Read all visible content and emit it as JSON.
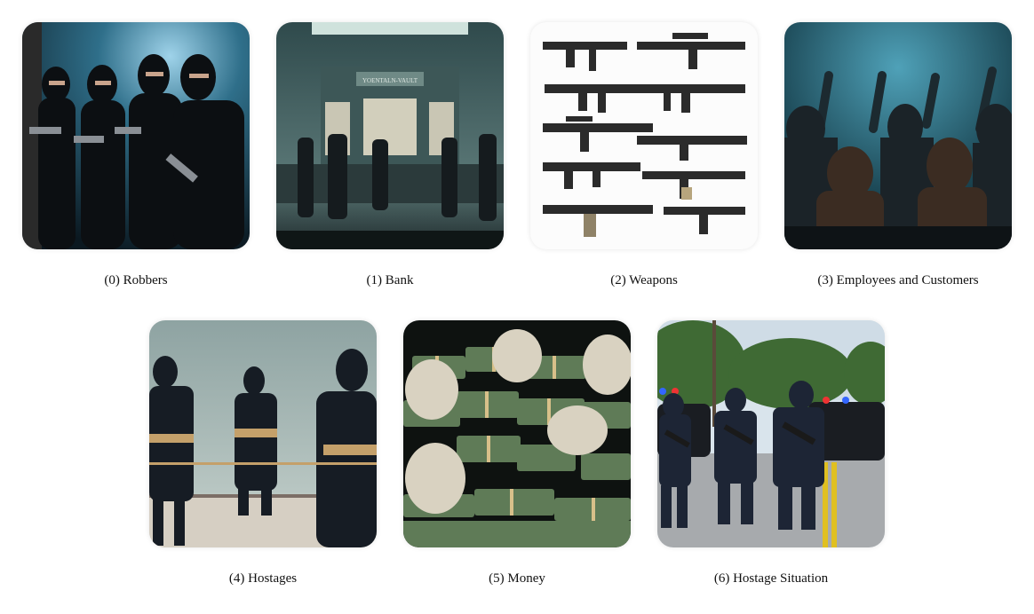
{
  "items": [
    {
      "caption": "(0) Robbers"
    },
    {
      "caption": "(1) Bank",
      "sign_text": "YOENTALN-VAULT"
    },
    {
      "caption": "(2) Weapons"
    },
    {
      "caption": "(3) Employees and Customers"
    },
    {
      "caption": "(4) Hostages"
    },
    {
      "caption": "(5) Money"
    },
    {
      "caption": "(6) Hostage Situation"
    }
  ]
}
